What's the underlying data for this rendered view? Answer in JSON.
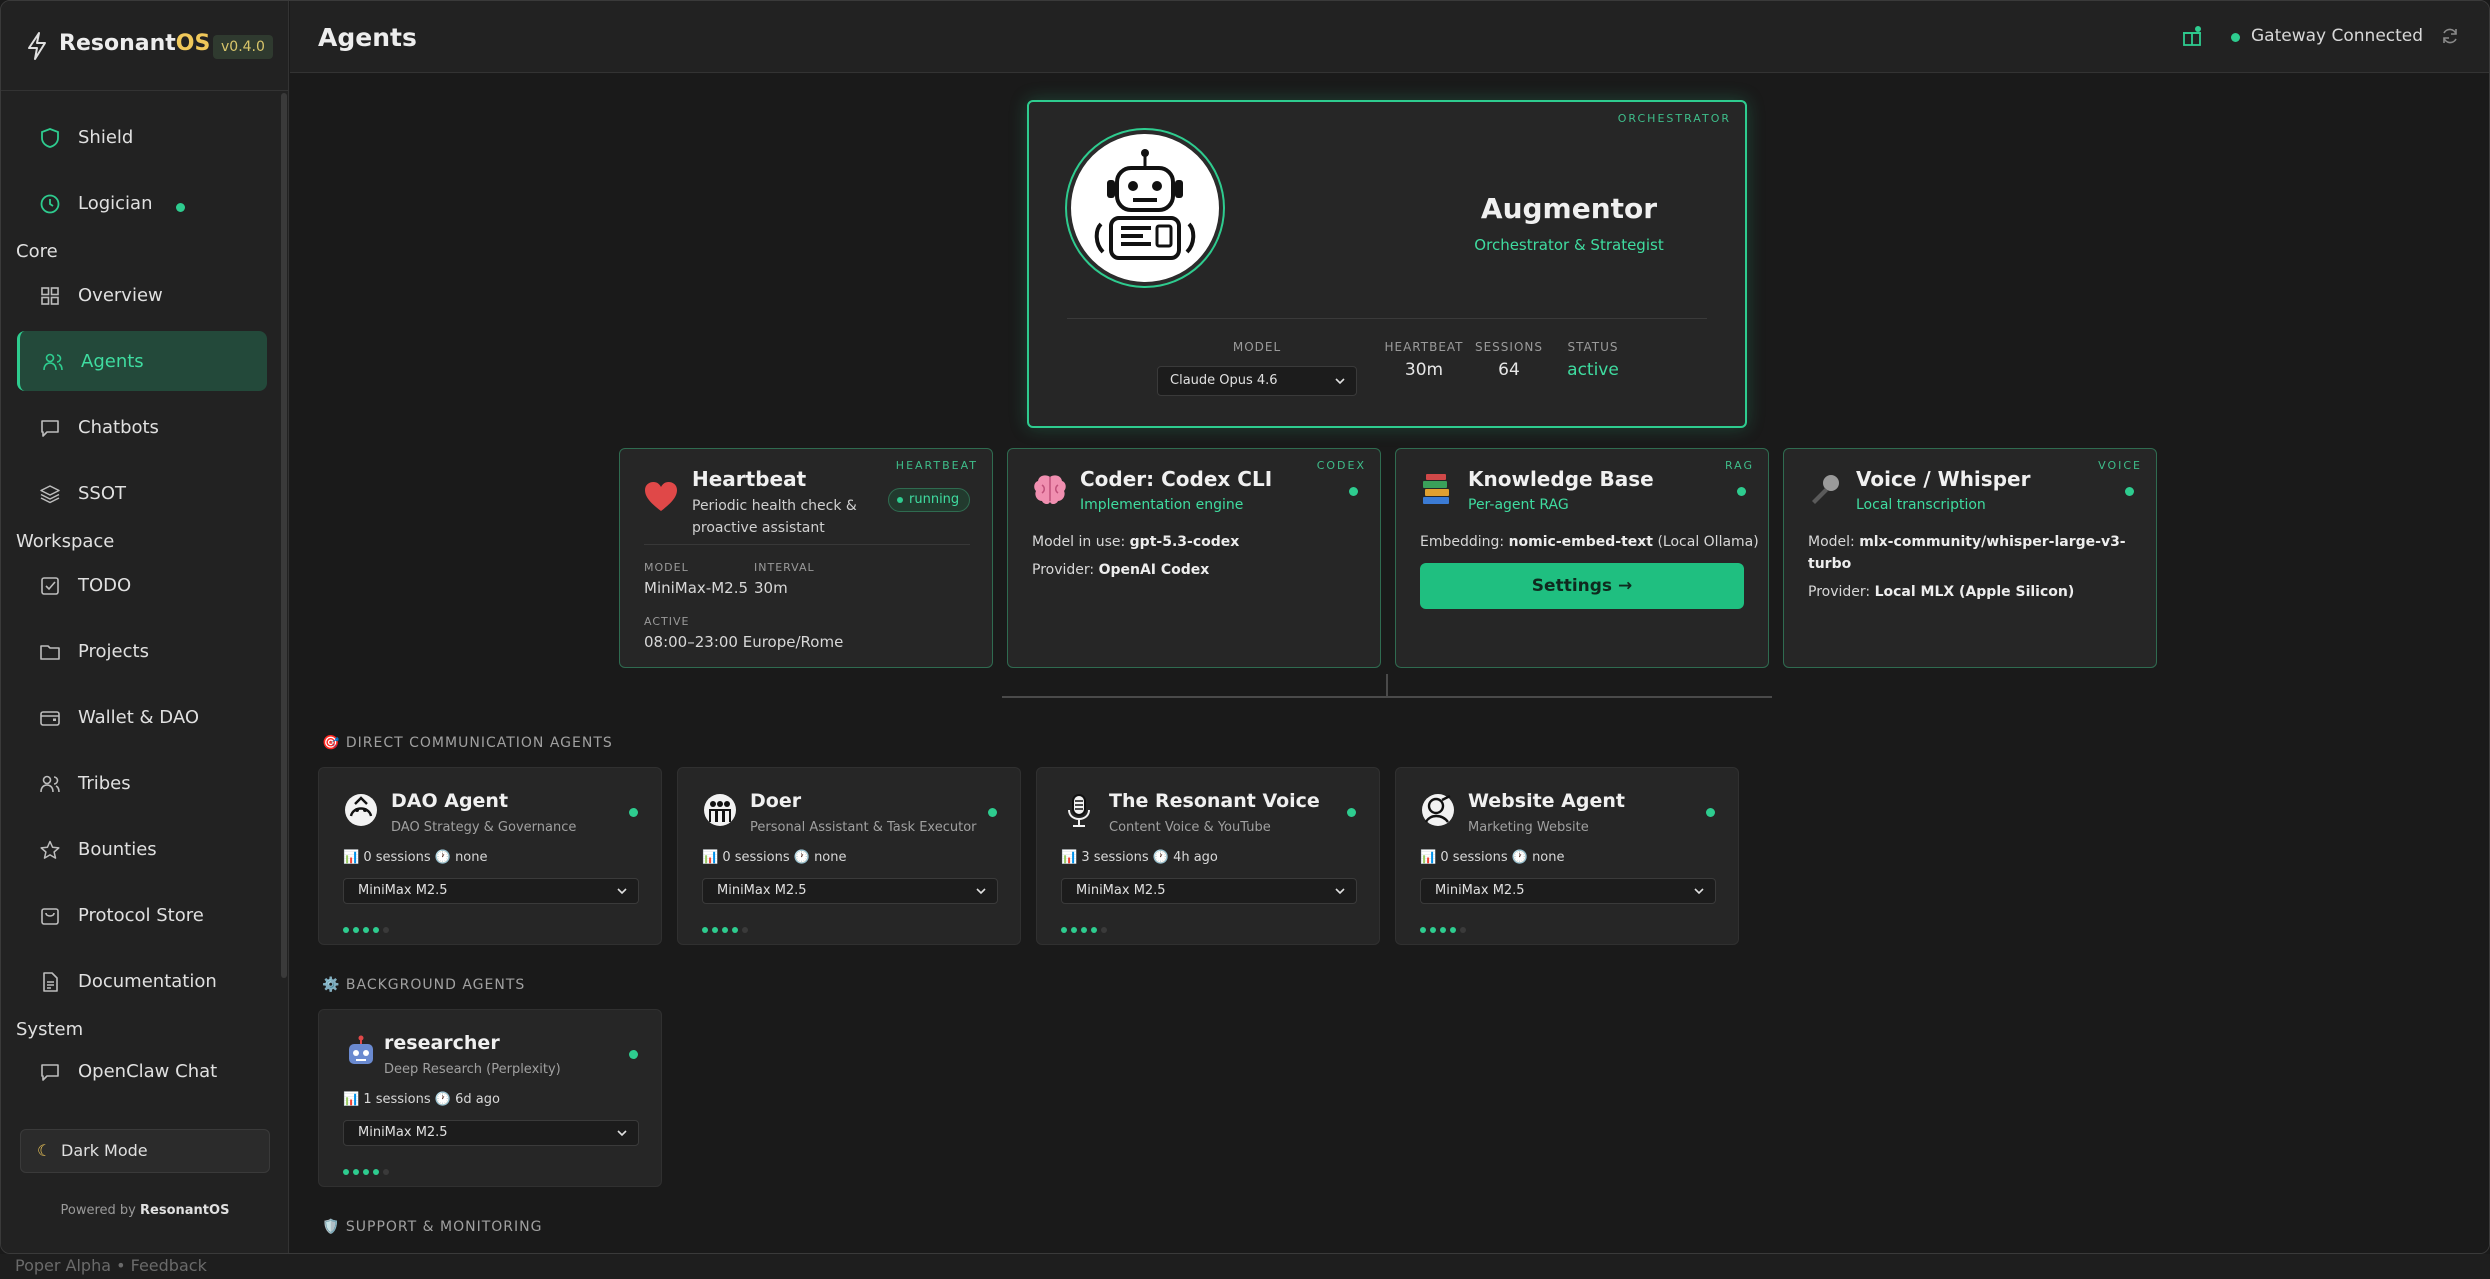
{
  "brand": {
    "name_main": "Resonant",
    "name_accent": "OS",
    "version": "v0.4.0"
  },
  "sidebar": {
    "items": [
      {
        "label": "Shield"
      },
      {
        "label": "Logician"
      },
      {
        "label": "Overview"
      },
      {
        "label": "Agents"
      },
      {
        "label": "Chatbots"
      },
      {
        "label": "SSOT"
      },
      {
        "label": "TODO"
      },
      {
        "label": "Projects"
      },
      {
        "label": "Wallet & DAO"
      },
      {
        "label": "Tribes"
      },
      {
        "label": "Bounties"
      },
      {
        "label": "Protocol Store"
      },
      {
        "label": "Documentation"
      },
      {
        "label": "OpenClaw Chat"
      }
    ],
    "sections": {
      "core": "Core",
      "workspace": "Workspace",
      "system": "System"
    },
    "dark_mode": "Dark Mode",
    "powered_prefix": "Powered by",
    "powered_brand": "ResonantOS"
  },
  "header": {
    "title": "Agents",
    "gateway": "Gateway Connected"
  },
  "orchestrator": {
    "tag": "ORCHESTRATOR",
    "name": "Augmentor",
    "role": "Orchestrator & Strategist",
    "model_label": "MODEL",
    "model_value": "Claude Opus 4.6",
    "heartbeat_label": "HEARTBEAT",
    "heartbeat_value": "30m",
    "sessions_label": "SESSIONS",
    "sessions_value": "64",
    "status_label": "STATUS",
    "status_value": "active"
  },
  "heartbeat": {
    "tag": "HEARTBEAT",
    "title": "Heartbeat",
    "desc1": "Periodic health check &",
    "desc2": "proactive assistant",
    "badge": "running",
    "model_label": "MODEL",
    "model_value": "MiniMax-M2.5",
    "interval_label": "INTERVAL",
    "interval_value": "30m",
    "active_label": "ACTIVE",
    "active_value": "08:00–23:00 Europe/Rome"
  },
  "codex": {
    "tag": "CODEX",
    "title": "Coder: Codex CLI",
    "subtitle": "Implementation engine",
    "model_prefix": "Model in use:",
    "model_value": "gpt-5.3-codex",
    "provider_prefix": "Provider:",
    "provider_value": "OpenAI Codex"
  },
  "rag": {
    "tag": "RAG",
    "title": "Knowledge Base",
    "subtitle": "Per-agent RAG",
    "embed_prefix": "Embedding:",
    "embed_value": "nomic-embed-text",
    "embed_suffix": "(Local Ollama)",
    "button": "Settings →"
  },
  "voice": {
    "tag": "VOICE",
    "title": "Voice / Whisper",
    "subtitle": "Local transcription",
    "model_prefix": "Model:",
    "model_line1": "mlx-community/whisper-large-v3-",
    "model_line2": "turbo",
    "provider_prefix": "Provider:",
    "provider_value": "Local MLX (Apple Silicon)"
  },
  "groups": {
    "direct": "🎯 DIRECT COMMUNICATION AGENTS",
    "background": "⚙️ BACKGROUND AGENTS",
    "support": "🛡️ SUPPORT & MONITORING"
  },
  "agents": [
    {
      "name": "DAO Agent",
      "desc": "DAO Strategy & Governance",
      "meta": "📊 0 sessions  🕐 none",
      "model": "MiniMax M2.5"
    },
    {
      "name": "Doer",
      "desc": "Personal Assistant & Task Executor",
      "meta": "📊 0 sessions  🕐 none",
      "model": "MiniMax M2.5"
    },
    {
      "name": "The Resonant Voice",
      "desc": "Content Voice & YouTube",
      "meta": "📊 3 sessions  🕐 4h ago",
      "model": "MiniMax M2.5"
    },
    {
      "name": "Website Agent",
      "desc": "Marketing Website",
      "meta": "📊 0 sessions  🕐 none",
      "model": "MiniMax M2.5"
    }
  ],
  "background_agents": [
    {
      "name": "researcher",
      "desc": "Deep Research (Perplexity)",
      "meta": "📊 1 sessions  🕐 6d ago",
      "model": "MiniMax M2.5"
    }
  ],
  "footer": {
    "text": "Poper Alpha  •  Feedback"
  },
  "colors": {
    "accent": "#2ecc8f",
    "brand_os": "#f0c85a",
    "bg": "#1a1a1a"
  }
}
